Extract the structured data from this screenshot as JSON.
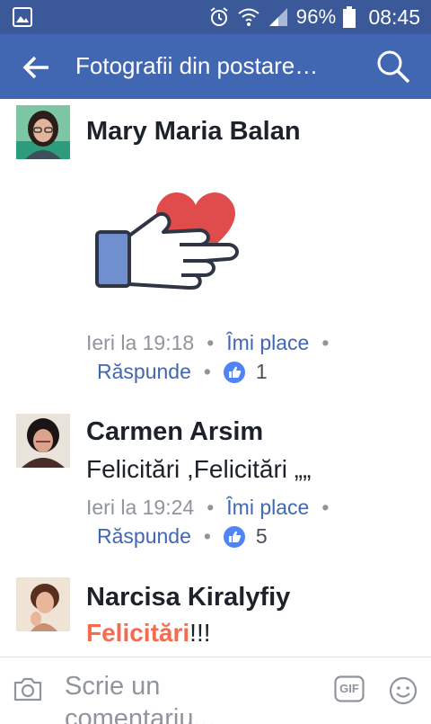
{
  "status_bar": {
    "battery_percent": "96%",
    "time": "08:45"
  },
  "app_bar": {
    "title": "Fotografii din postare…"
  },
  "comments": [
    {
      "author": "Mary Maria Balan",
      "timestamp": "Ieri la 19:18",
      "like_label": "Îmi place",
      "reply_label": "Răspunde",
      "like_count": "1"
    },
    {
      "author": "Carmen Arsim",
      "text": "Felicitări ,Felicitări „„",
      "timestamp": "Ieri la 19:24",
      "like_label": "Îmi place",
      "reply_label": "Răspunde",
      "like_count": "5"
    },
    {
      "author": "Narcisa Kiralyfiy",
      "text_highlight": "Felicitări",
      "text_rest": "!!!"
    }
  ],
  "composer": {
    "placeholder": "Scrie un comentariu...",
    "gif_label": "GIF"
  },
  "colors": {
    "status_bar": "#3b5998",
    "app_bar": "#4267b2",
    "link": "#4267b2",
    "highlight": "#f56b50"
  }
}
